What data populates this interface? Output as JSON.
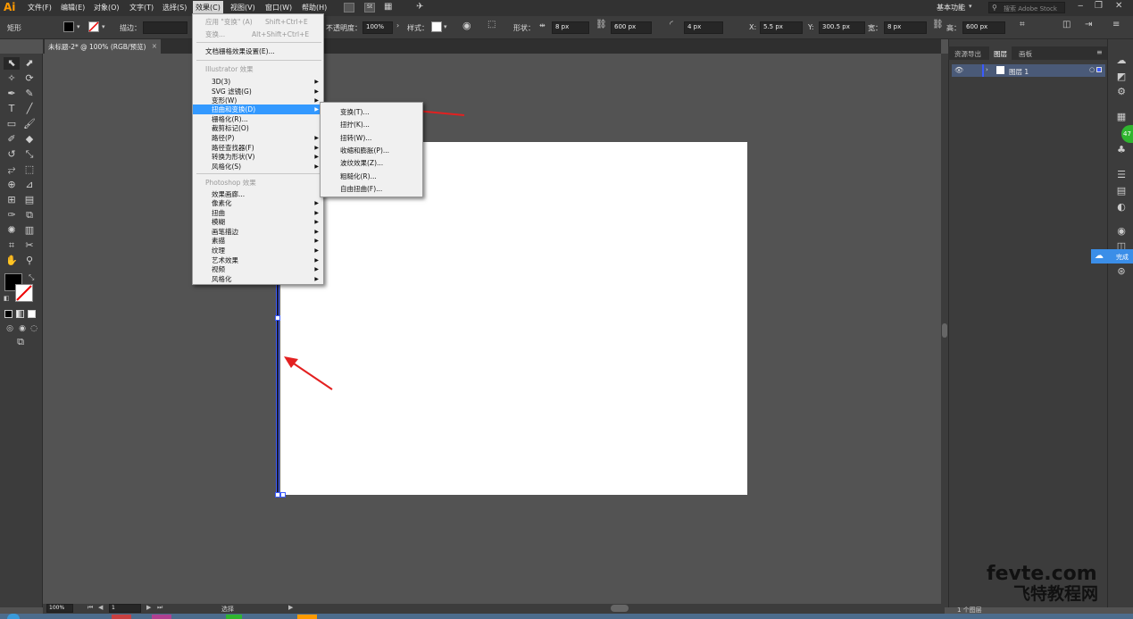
{
  "app": {
    "logo": "Ai"
  },
  "menubar": {
    "items": [
      "文件(F)",
      "编辑(E)",
      "对象(O)",
      "文字(T)",
      "选择(S)",
      "效果(C)",
      "视图(V)",
      "窗口(W)",
      "帮助(H)"
    ],
    "workspace": "基本功能",
    "search_placeholder": "搜索 Adobe Stock"
  },
  "control": {
    "shape_label": "矩形",
    "stroke_label": "描边：",
    "opacity_label": "不透明度：",
    "opacity_value": "100%",
    "style_label": "样式：",
    "shape_type_label": "形状：",
    "width_px": "8 px",
    "height_px": "600 px",
    "corner": "4 px",
    "x_label": "X:",
    "x_value": "5.5 px",
    "y_label": "Y:",
    "y_value": "300.5 px",
    "w_label": "宽：",
    "w_value": "8 px",
    "h_label": "高：",
    "h_value": "600 px"
  },
  "document": {
    "tab_title": "未标题-2* @ 100% (RGB/预览)"
  },
  "effect_menu": {
    "apply_label": "应用 \"变换\" (A)",
    "apply_shortcut": "Shift+Ctrl+E",
    "transform_label": "变换...",
    "transform_shortcut": "Alt+Shift+Ctrl+E",
    "raster_settings": "文档栅格效果设置(E)...",
    "illustrator_section": "Illustrator 效果",
    "illustrator_items": [
      "3D(3)",
      "SVG 滤镜(G)",
      "变形(W)",
      "扭曲和变换(D)",
      "栅格化(R)...",
      "裁剪标记(O)",
      "路径(P)",
      "路径查找器(F)",
      "转换为形状(V)",
      "风格化(S)"
    ],
    "photoshop_section": "Photoshop 效果",
    "photoshop_items": [
      "效果画廊...",
      "像素化",
      "扭曲",
      "模糊",
      "画笔描边",
      "素描",
      "纹理",
      "艺术效果",
      "视频",
      "风格化"
    ]
  },
  "distort_submenu": {
    "items": [
      "变换(T)...",
      "扭拧(K)...",
      "扭转(W)...",
      "收缩和膨胀(P)...",
      "波纹效果(Z)...",
      "粗糙化(R)...",
      "自由扭曲(F)..."
    ]
  },
  "panels": {
    "tabs": [
      "资源导出",
      "图层",
      "画板"
    ],
    "layer_name": "图层 1",
    "footer": "1 个图层"
  },
  "status": {
    "zoom": "100%",
    "artboard": "1",
    "mode": "选择"
  },
  "sidebar_badge": "47",
  "flyout_label": "完成",
  "watermark": {
    "line1": "fevte.com",
    "line2": "飞特教程网"
  },
  "colors": {
    "accent": "#3399ff",
    "arrow": "#e32020",
    "selection": "#3b5bff"
  }
}
